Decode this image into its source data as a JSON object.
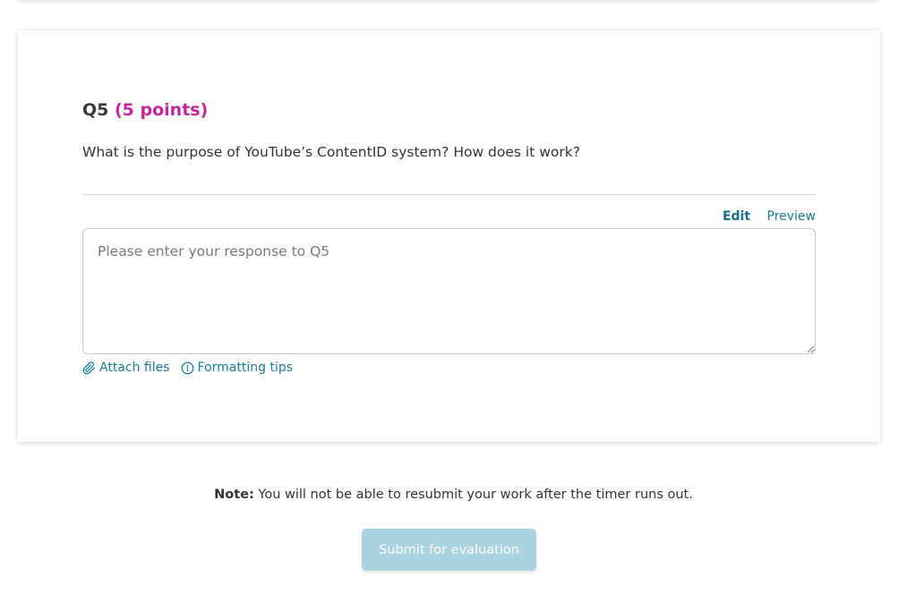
{
  "question": {
    "number": "Q5",
    "points": "(5 points)",
    "prompt": "What is the purpose of YouTube’s ContentID system? How does it work?"
  },
  "editor": {
    "tabs": [
      {
        "label": "Edit",
        "active": true
      },
      {
        "label": "Preview",
        "active": false
      }
    ],
    "placeholder": "Please enter your response to Q5",
    "value": ""
  },
  "links": {
    "attach": "Attach files",
    "formatting": "Formatting tips"
  },
  "note": {
    "label": "Note:",
    "text": " You will not be able to resubmit your work after the timer runs out."
  },
  "submit": {
    "label": "Submit for evaluation",
    "disabled": true
  },
  "colors": {
    "accent": "#1a7d96",
    "points": "#c2279b",
    "submit_disabled": "#a8d3df"
  }
}
